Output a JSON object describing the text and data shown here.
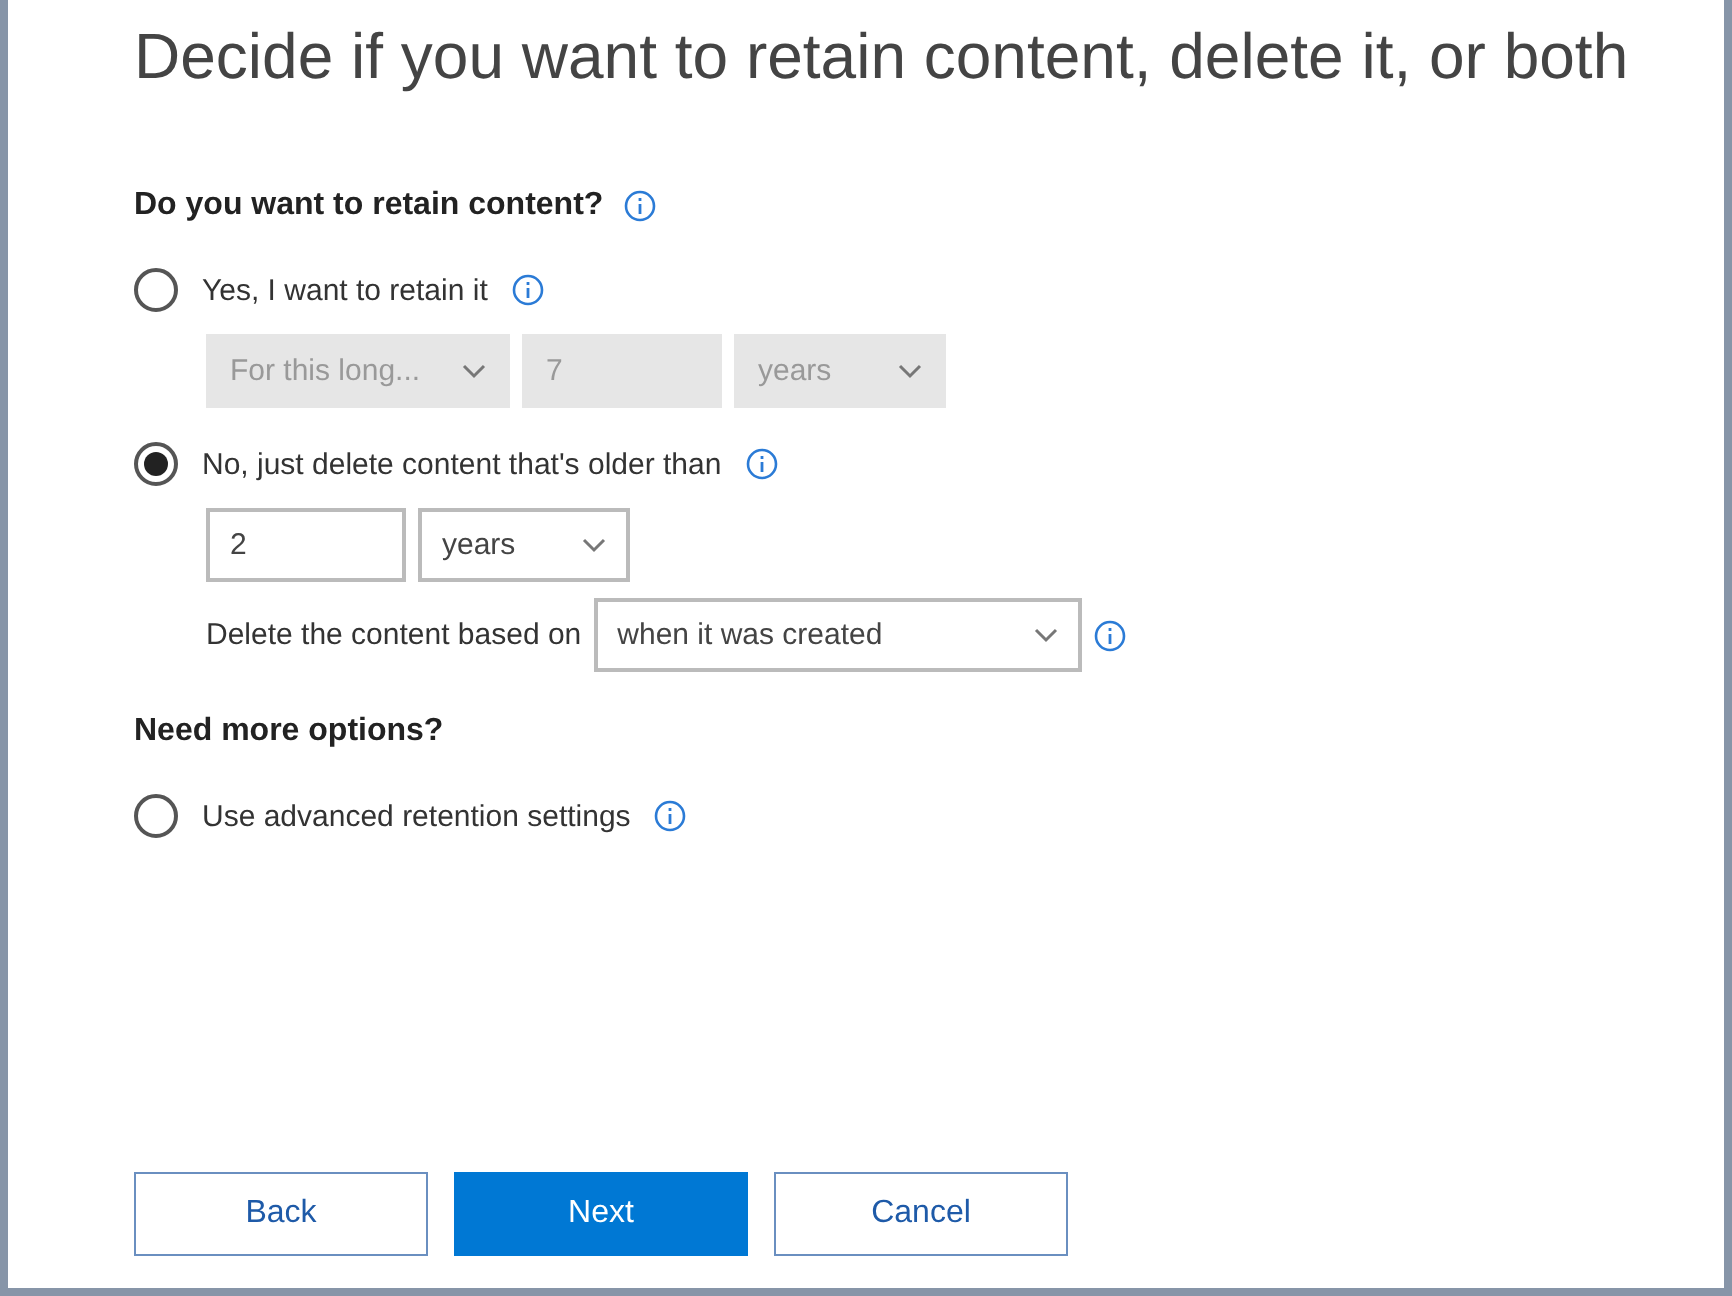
{
  "title": "Decide if you want to retain content, delete it, or both",
  "sections": [
    {
      "heading": "Do you want to retain content?",
      "info": true,
      "options": [
        {
          "label": "Yes, I want to retain it",
          "selected": false,
          "info": true,
          "controls": [
            {
              "kind": "dropdown",
              "value": "For this long...",
              "disabled": true
            },
            {
              "kind": "field",
              "value": "7",
              "disabled": true
            },
            {
              "kind": "dropdown",
              "value": "years",
              "disabled": true
            }
          ]
        },
        {
          "label": "No, just delete content that's older than",
          "selected": true,
          "info": true,
          "controls": [
            {
              "kind": "field",
              "value": "2",
              "disabled": false
            },
            {
              "kind": "dropdown",
              "value": "years",
              "disabled": false
            }
          ],
          "extra": {
            "label": "Delete the content based on",
            "dropdown": "when it was created",
            "info": true
          }
        }
      ]
    },
    {
      "heading": "Need more options?",
      "options": [
        {
          "label": "Use advanced retention settings",
          "selected": false,
          "info": true
        }
      ]
    }
  ],
  "buttons": [
    {
      "label": "Back",
      "primary": false
    },
    {
      "label": "Next",
      "primary": true
    },
    {
      "label": "Cancel",
      "primary": false
    }
  ]
}
